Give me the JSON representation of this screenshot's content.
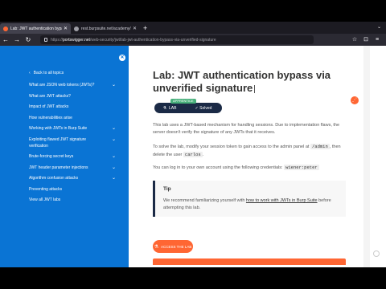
{
  "browser": {
    "tabs": [
      {
        "title": "Lab: JWT authentication bypas",
        "active": true,
        "favicon_color": "#ff6633"
      },
      {
        "title": "rest.burpsuite.net/academy/labs...",
        "active": false,
        "favicon_color": "#9e9ea6"
      }
    ],
    "new_tab_label": "+",
    "url_prefix": "https://",
    "url_host": "portswigger.net",
    "url_path": "/web-security/jwt/lab-jwt-authentication-bypass-via-unverified-signature"
  },
  "sidebar": {
    "back_label": "Back to all topics",
    "items": [
      {
        "label": "What are JSON web tokens (JWTs)?",
        "expandable": true
      },
      {
        "label": "What are JWT attacks?",
        "expandable": false
      },
      {
        "label": "Impact of JWT attacks",
        "expandable": false
      },
      {
        "label": "How vulnerabilities arise",
        "expandable": false
      },
      {
        "label": "Working with JWTs in Burp Suite",
        "expandable": true
      },
      {
        "label": "Exploiting flawed JWT signature verification",
        "expandable": true
      },
      {
        "label": "Brute-forcing secret keys",
        "expandable": true
      },
      {
        "label": "JWT header parameter injections",
        "expandable": true
      },
      {
        "label": "Algorithm confusion attacks",
        "expandable": true
      },
      {
        "label": "Preventing attacks",
        "expandable": false
      },
      {
        "label": "View all JWT labs",
        "expandable": false
      }
    ]
  },
  "main": {
    "title": "Lab: JWT authentication bypass via unverified signature",
    "badge": {
      "level": "APPRENTICE",
      "lab": "LAB",
      "status": "Solved"
    },
    "para1": "This lab uses a JWT-based mechanism for handling sessions. Due to implementation flaws, the server doesn't verify the signature of any JWTs that it receives.",
    "para2_a": "To solve the lab, modify your session token to gain access to the admin panel at",
    "para2_code1": "/admin",
    "para2_b": ", then delete the user",
    "para2_code2": "carlos",
    "para2_c": ".",
    "para3_a": "You can log in to your own account using the following credentials:",
    "para3_code": "wiener:peter",
    "tip_title": "Tip",
    "tip_a": "We recommend familiarizing yourself with",
    "tip_link": "how to work with JWTs in Burp Suite",
    "tip_b": "before attempting this lab.",
    "access_button": "ACCESS THE LAB"
  },
  "colors": {
    "accent": "#ff6633",
    "sidebar": "#0a74d4",
    "navy": "#1b2a46",
    "success": "#48b07b"
  }
}
